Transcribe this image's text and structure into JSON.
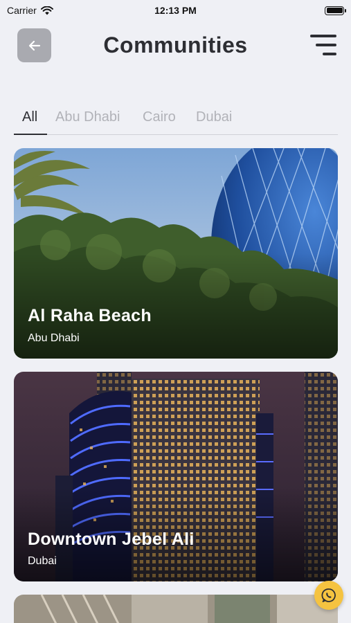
{
  "status_bar": {
    "carrier": "Carrier",
    "time": "12:13 PM"
  },
  "header": {
    "title": "Communities"
  },
  "tabs": [
    {
      "label": "All",
      "active": true
    },
    {
      "label": "Abu Dhabi",
      "active": false
    },
    {
      "label": "Cairo",
      "active": false
    },
    {
      "label": "Dubai",
      "active": false
    }
  ],
  "communities": [
    {
      "name": "Al Raha Beach",
      "city": "Abu Dhabi"
    },
    {
      "name": "Downtown Jebel Ali",
      "city": "Dubai"
    }
  ],
  "colors": {
    "background": "#eff0f5",
    "back_button": "#a9aab0",
    "title_text": "#2d2e33",
    "tab_inactive": "#b1b2b8",
    "whatsapp_button": "#f5c340"
  },
  "icons": {
    "back": "arrow-left-icon",
    "menu": "menu-icon",
    "wifi": "wifi-icon",
    "battery": "battery-icon",
    "chat": "whatsapp-icon"
  }
}
